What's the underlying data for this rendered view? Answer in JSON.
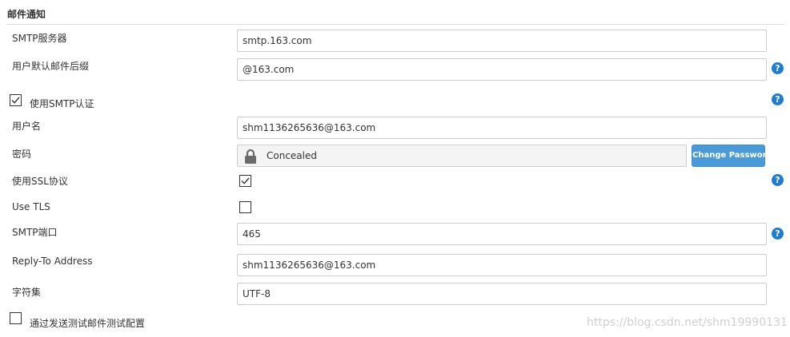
{
  "section": {
    "title": "邮件通知"
  },
  "fields": {
    "smtp_server": {
      "label": "SMTP服务器",
      "value": "smtp.163.com"
    },
    "default_suffix": {
      "label": "用户默认邮件后缀",
      "value": "@163.com"
    },
    "use_smtp_auth": {
      "label": "使用SMTP认证",
      "checked": true
    },
    "username": {
      "label": "用户名",
      "value": "shm1136265636@163.com"
    },
    "password": {
      "label": "密码",
      "value": "Concealed",
      "button_label": "Change Password"
    },
    "use_ssl": {
      "label": "使用SSL协议",
      "checked": true
    },
    "use_tls": {
      "label": "Use TLS",
      "checked": false
    },
    "smtp_port": {
      "label": "SMTP端口",
      "value": "465"
    },
    "reply_to": {
      "label": "Reply-To Address",
      "value": "shm1136265636@163.com"
    },
    "charset": {
      "label": "字符集",
      "value": "UTF-8"
    },
    "test_config": {
      "label": "通过发送测试邮件测试配置",
      "checked": false
    }
  },
  "help_icon_glyph": "?",
  "watermark": "https://blog.csdn.net/shm19990131",
  "colors": {
    "help_icon": "#1f7ccf",
    "button": "#4a9ad8"
  }
}
